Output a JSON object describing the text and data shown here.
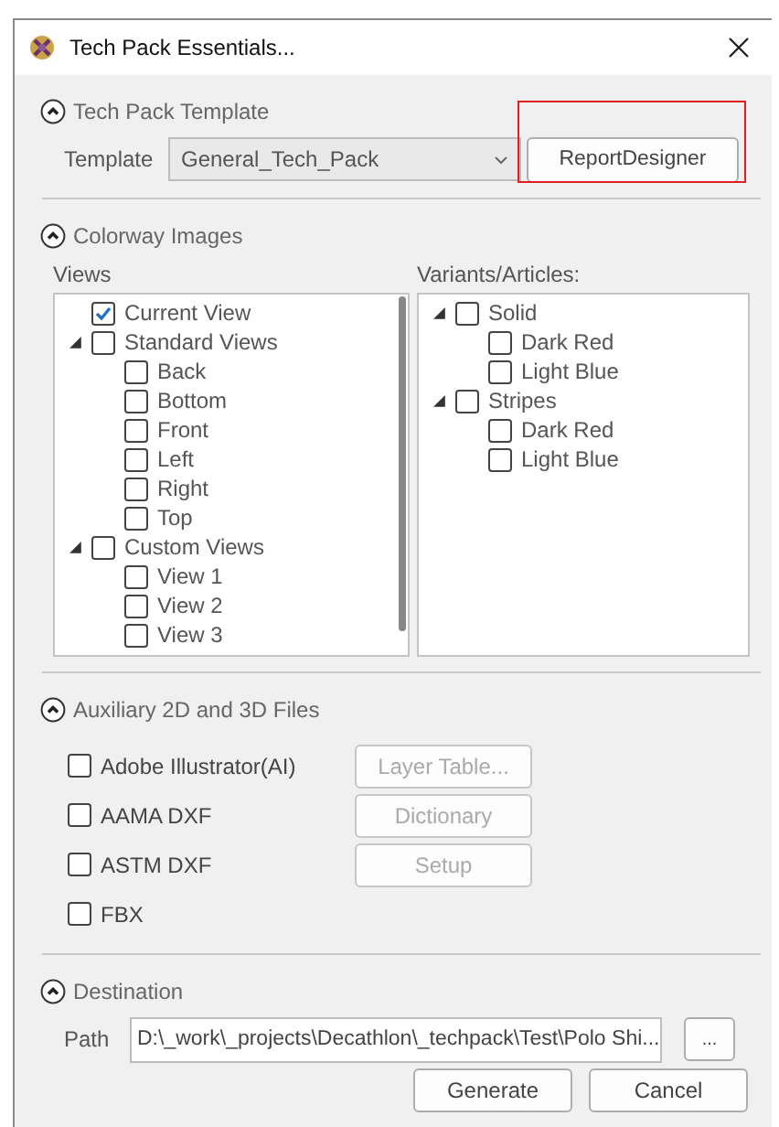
{
  "window": {
    "title": "Tech Pack Essentials..."
  },
  "template_section": {
    "title": "Tech Pack Template",
    "expanded": true,
    "label": "Template",
    "value": "General_Tech_Pack",
    "button": "ReportDesigner"
  },
  "colorway_section": {
    "title": "Colorway Images",
    "expanded": true,
    "views_label": "Views",
    "variants_label": "Variants/Articles:",
    "views": [
      {
        "label": "Current View",
        "checked": true
      },
      {
        "label": "Standard Views",
        "checked": false,
        "expanded": true,
        "children": [
          {
            "label": "Back",
            "checked": false
          },
          {
            "label": "Bottom",
            "checked": false
          },
          {
            "label": "Front",
            "checked": false
          },
          {
            "label": "Left",
            "checked": false
          },
          {
            "label": "Right",
            "checked": false
          },
          {
            "label": "Top",
            "checked": false
          }
        ]
      },
      {
        "label": "Custom Views",
        "checked": false,
        "expanded": true,
        "children": [
          {
            "label": "View 1",
            "checked": false
          },
          {
            "label": "View 2",
            "checked": false
          },
          {
            "label": "View 3",
            "checked": false
          }
        ]
      }
    ],
    "variants": [
      {
        "label": "Solid",
        "checked": false,
        "expanded": true,
        "children": [
          {
            "label": "Dark Red",
            "checked": false
          },
          {
            "label": "Light Blue",
            "checked": false
          }
        ]
      },
      {
        "label": "Stripes",
        "checked": false,
        "expanded": true,
        "children": [
          {
            "label": "Dark Red",
            "checked": false
          },
          {
            "label": "Light Blue",
            "checked": false
          }
        ]
      }
    ]
  },
  "auxiliary_section": {
    "title": "Auxiliary 2D and 3D Files",
    "expanded": true,
    "files": [
      {
        "label": "Adobe Illustrator(AI)",
        "checked": false,
        "button": {
          "label": "Layer Table...",
          "disabled": true
        }
      },
      {
        "label": "AAMA DXF",
        "checked": false,
        "button": {
          "label": "Dictionary",
          "disabled": true
        }
      },
      {
        "label": "ASTM DXF",
        "checked": false,
        "button": {
          "label": "Setup",
          "disabled": true
        }
      },
      {
        "label": "FBX",
        "checked": false
      }
    ]
  },
  "destination_section": {
    "title": "Destination",
    "expanded": true,
    "label": "Path",
    "value": "D:\\_work\\_projects\\Decathlon\\_techpack\\Test\\Polo Shi...",
    "browse": "..."
  },
  "buttons": [
    "Generate",
    "Cancel"
  ]
}
